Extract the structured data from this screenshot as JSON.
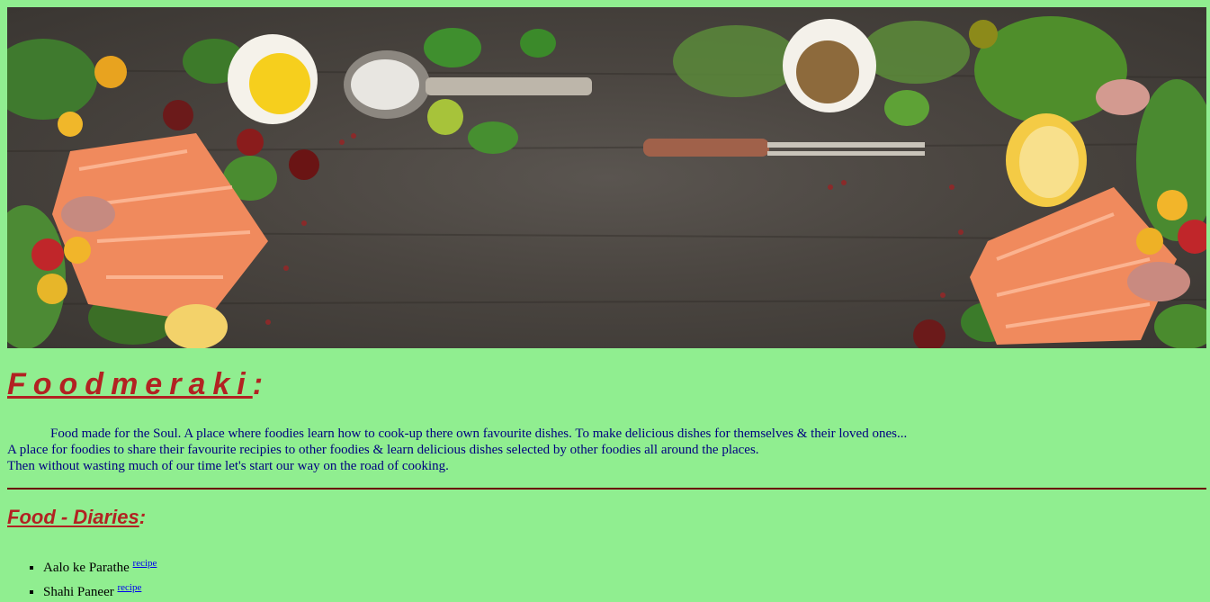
{
  "banner": {
    "alt": "food-ingredients-banner"
  },
  "header": {
    "title": "Foodmeraki",
    "colon": ":"
  },
  "intro": {
    "line1": "Food made for the Soul. A place where foodies learn how to cook-up there own favourite dishes. To make delicious dishes for themselves & their loved ones...",
    "line2": "A place for foodies to share their favourite recipies to other foodies & learn delicious dishes selected by other foodies all around the places.",
    "line3": "Then without wasting much of our time let's start our way on the road of cooking."
  },
  "section": {
    "title": "Food - Diaries",
    "colon": ":"
  },
  "recipes": [
    {
      "name": "Aalo ke Parathe",
      "link": "recipe"
    },
    {
      "name": "Shahi Paneer",
      "link": "recipe"
    }
  ],
  "colors": {
    "background": "#90ee90",
    "title": "#b22222",
    "intro_text": "#000080",
    "divider": "#6b0000",
    "link": "#0000ee"
  }
}
